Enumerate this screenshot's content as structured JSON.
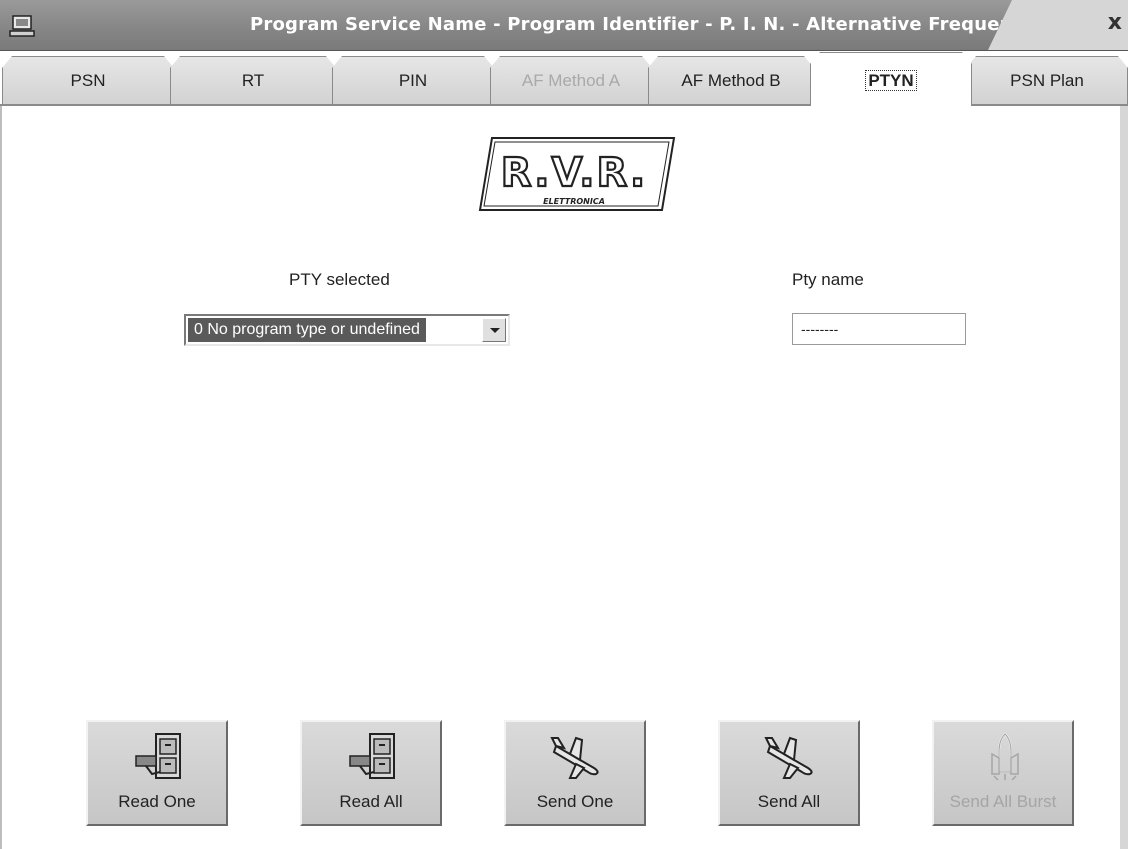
{
  "window": {
    "title": "Program Service Name - Program Identifier - P. I. N. - Alternative Frequency",
    "close_symbol": "x",
    "app_icon": "computer-icon"
  },
  "tabs": [
    {
      "label": "PSN",
      "state": "normal"
    },
    {
      "label": "RT",
      "state": "normal"
    },
    {
      "label": "PIN",
      "state": "normal"
    },
    {
      "label": "AF Method A",
      "state": "disabled"
    },
    {
      "label": "AF Method B",
      "state": "normal"
    },
    {
      "label": "PTYN",
      "state": "active"
    },
    {
      "label": "PSN Plan",
      "state": "normal"
    }
  ],
  "logo": {
    "main": "R.V.R.",
    "sub": "ELETTRONICA"
  },
  "pty": {
    "label": "PTY selected",
    "selected_value": "0   No program type or undefined"
  },
  "ptyname": {
    "label": "Pty name",
    "value": "--------"
  },
  "buttons": [
    {
      "label": "Read One",
      "icon": "file-cabinet-icon",
      "enabled": true
    },
    {
      "label": "Read All",
      "icon": "file-cabinet-icon",
      "enabled": true
    },
    {
      "label": "Send One",
      "icon": "airplane-icon",
      "enabled": true
    },
    {
      "label": "Send All",
      "icon": "airplane-icon",
      "enabled": true
    },
    {
      "label": "Send All Burst",
      "icon": "space-shuttle-icon",
      "enabled": false
    }
  ],
  "colors": {
    "titlebar": "#858585",
    "tab_face": "#d8d8d8",
    "selection": "#5a5a5a",
    "disabled_text": "#a9a9a9"
  }
}
